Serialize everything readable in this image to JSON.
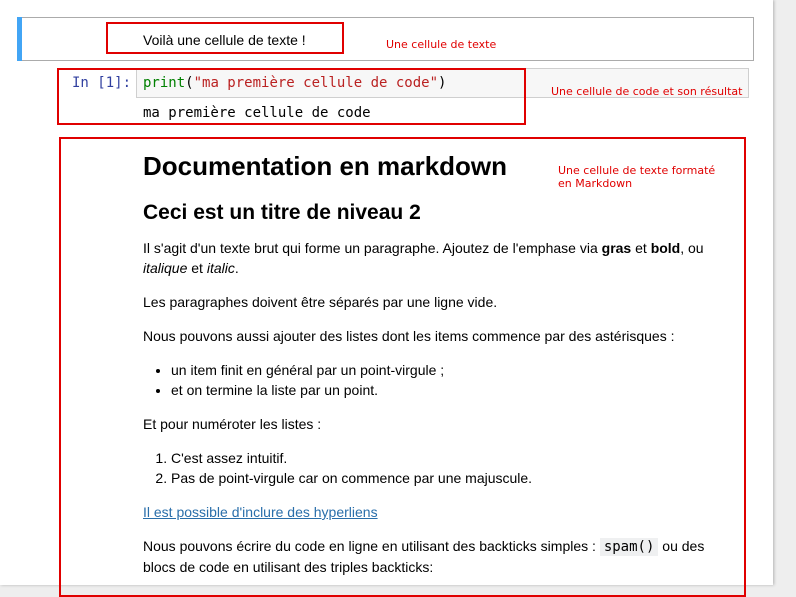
{
  "cells": {
    "markdown_1": {
      "text": "Voilà une cellule de texte !"
    },
    "code_1": {
      "prompt": "In [1]:",
      "func": "print",
      "open_paren": "(",
      "string": "\"ma première cellule de code\"",
      "close_paren": ")",
      "output": "ma première cellule de code"
    },
    "markdown_2": {
      "h1": "Documentation en markdown",
      "h2": "Ceci est un titre de niveau 2",
      "p1_a": "Il s'agit d'un texte brut qui forme un paragraphe. Ajoutez de l'emphase via ",
      "p1_bold1": "gras",
      "p1_b": " et ",
      "p1_bold2": "bold",
      "p1_c": ", ou ",
      "p1_it1": "italique",
      "p1_d": " et ",
      "p1_it2": "italic",
      "p1_e": ".",
      "p2": "Les paragraphes doivent être séparés par une ligne vide.",
      "p3": "Nous pouvons aussi ajouter des listes dont les items commence par des astérisques :",
      "ul": [
        "un item finit en général par un point-virgule ;",
        "et on termine la liste par un point."
      ],
      "p4": "Et pour numéroter les listes :",
      "ol": [
        "C'est assez intuitif.",
        "Pas de point-virgule car on commence par une majuscule."
      ],
      "link": "Il est possible d'inclure des hyperliens",
      "p5_a": "Nous pouvons écrire du code en ligne en utilisant des backticks simples : ",
      "p5_code": "spam()",
      "p5_b": " ou des blocs de code en utilisant des triples backticks:"
    }
  },
  "annotations": {
    "label_1": "Une cellule de texte",
    "label_2": "Une cellule de code et son résultat",
    "label_3_line1": "Une cellule de texte formaté",
    "label_3_line2": "en Markdown"
  },
  "colors": {
    "annotation": "#e00000",
    "selected_bar": "#42a5f5",
    "prompt": "#303f9f",
    "builtin": "#008000",
    "string": "#ba2121",
    "link": "#296eaa"
  }
}
